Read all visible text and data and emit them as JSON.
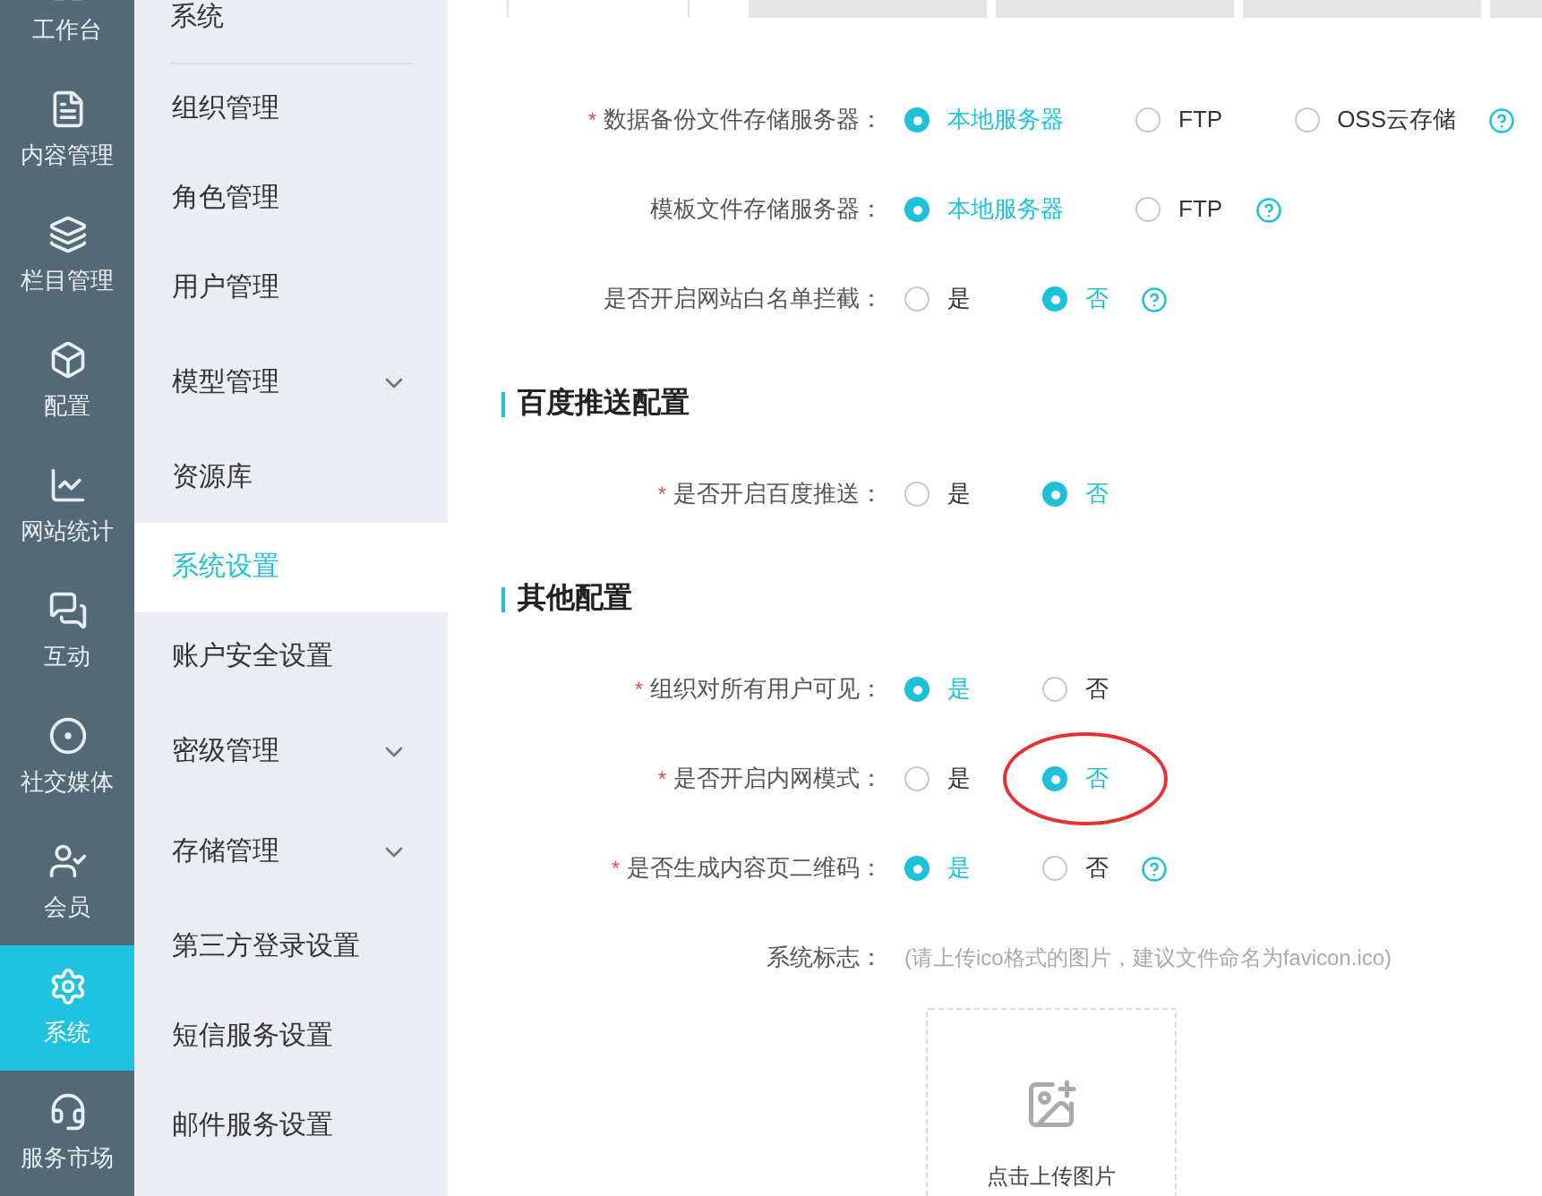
{
  "nav": [
    {
      "label": "工作台",
      "selected": false
    },
    {
      "label": "内容管理",
      "selected": false
    },
    {
      "label": "栏目管理",
      "selected": false
    },
    {
      "label": "配置",
      "selected": false
    },
    {
      "label": "网站统计",
      "selected": false
    },
    {
      "label": "互动",
      "selected": false
    },
    {
      "label": "社交媒体",
      "selected": false
    },
    {
      "label": "会员",
      "selected": false
    },
    {
      "label": "系统",
      "selected": true
    },
    {
      "label": "服务市场",
      "selected": false
    }
  ],
  "submenu": {
    "title": "系统",
    "items": [
      {
        "label": "组织管理",
        "expandable": false,
        "selected": false
      },
      {
        "label": "角色管理",
        "expandable": false,
        "selected": false
      },
      {
        "label": "用户管理",
        "expandable": false,
        "selected": false
      },
      {
        "label": "模型管理",
        "expandable": true,
        "selected": false
      },
      {
        "label": "资源库",
        "expandable": false,
        "selected": false
      },
      {
        "label": "系统设置",
        "expandable": false,
        "selected": true
      },
      {
        "label": "账户安全设置",
        "expandable": false,
        "selected": false
      },
      {
        "label": "密级管理",
        "expandable": true,
        "selected": false
      },
      {
        "label": "存储管理",
        "expandable": true,
        "selected": false
      },
      {
        "label": "第三方登录设置",
        "expandable": false,
        "selected": false
      },
      {
        "label": "短信服务设置",
        "expandable": false,
        "selected": false
      },
      {
        "label": "邮件服务设置",
        "expandable": false,
        "selected": false
      }
    ]
  },
  "tabs": [
    {
      "selected": true
    },
    {
      "selected": false
    },
    {
      "selected": false
    },
    {
      "selected": false
    },
    {
      "selected": false
    }
  ],
  "sections": [
    {
      "rows": [
        {
          "label": "数据备份文件存储服务器：",
          "required_mark": "*",
          "help": true,
          "options": [
            {
              "label": "本地服务器",
              "selected": true,
              "circled": false
            },
            {
              "label": "FTP",
              "selected": false,
              "circled": false
            },
            {
              "label": "OSS云存储",
              "selected": false,
              "circled": false
            }
          ]
        },
        {
          "label": "模板文件存储服务器：",
          "help": true,
          "options": [
            {
              "label": "本地服务器",
              "selected": true,
              "circled": false
            },
            {
              "label": "FTP",
              "selected": false,
              "circled": false
            }
          ]
        },
        {
          "label": "是否开启网站白名单拦截：",
          "help": true,
          "options": [
            {
              "label": "是",
              "selected": false,
              "circled": false
            },
            {
              "label": "否",
              "selected": true,
              "circled": false
            }
          ]
        }
      ]
    },
    {
      "title": "百度推送配置",
      "rows": [
        {
          "label": "是否开启百度推送：",
          "required_mark": "*",
          "help": false,
          "options": [
            {
              "label": "是",
              "selected": false,
              "circled": false
            },
            {
              "label": "否",
              "selected": true,
              "circled": false
            }
          ]
        }
      ]
    },
    {
      "title": "其他配置",
      "rows": [
        {
          "label": "组织对所有用户可见：",
          "required_mark": "*",
          "help": false,
          "options": [
            {
              "label": "是",
              "selected": true,
              "circled": false
            },
            {
              "label": "否",
              "selected": false,
              "circled": false
            }
          ]
        },
        {
          "label": "是否开启内网模式：",
          "required_mark": "*",
          "help": false,
          "options": [
            {
              "label": "是",
              "selected": false,
              "circled": false
            },
            {
              "label": "否",
              "selected": true,
              "circled": true
            }
          ]
        },
        {
          "label": "是否生成内容页二维码：",
          "required_mark": "*",
          "help": true,
          "options": [
            {
              "label": "是",
              "selected": true,
              "circled": false
            },
            {
              "label": "否",
              "selected": false,
              "circled": false
            }
          ]
        }
      ]
    }
  ],
  "logo_field": {
    "label": "系统标志：",
    "hint": "(请上传ico格式的图片，建议文件命名为favicon.ico)",
    "upload_label": "点击上传图片"
  }
}
